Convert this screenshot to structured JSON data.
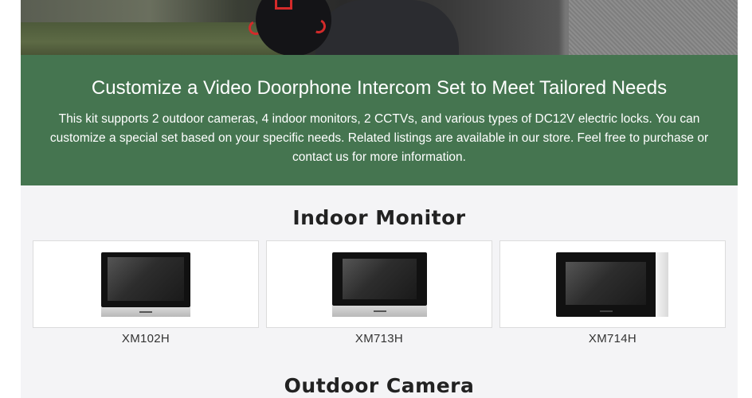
{
  "banner": {
    "title": "Customize a Video Doorphone Intercom Set to Meet Tailored Needs",
    "description": "This kit supports 2 outdoor cameras, 4 indoor monitors, 2 CCTVs, and various types of DC12V electric locks. You can customize a special set based on your specific needs. Related listings are available in our store. Feel free to purchase or contact us for more information.",
    "background_color": "#457550"
  },
  "indoor_monitor": {
    "section_title": "Indoor Monitor",
    "products": [
      {
        "model": "XM102H"
      },
      {
        "model": "XM713H"
      },
      {
        "model": "XM714H"
      }
    ]
  },
  "outdoor_camera": {
    "section_title": "Outdoor Camera"
  }
}
